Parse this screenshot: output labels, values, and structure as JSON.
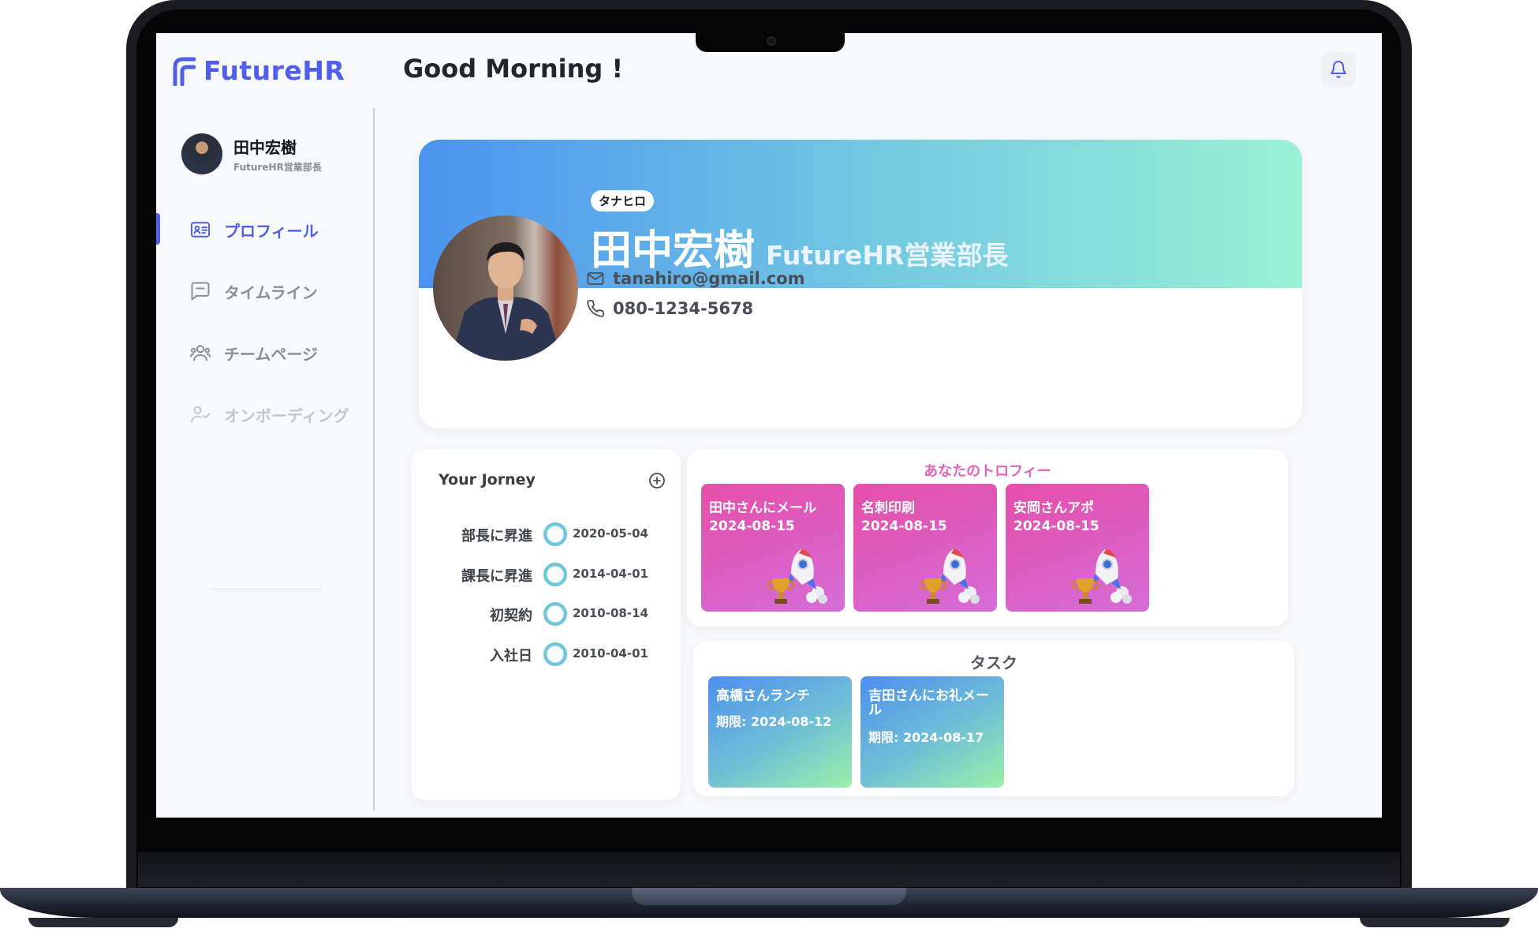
{
  "brand": {
    "name": "FutureHR",
    "color": "#4f5fe8"
  },
  "header": {
    "greeting": "Good Morning !",
    "bell_icon": "bell-icon"
  },
  "sidebar": {
    "user": {
      "name": "田中宏樹",
      "role": "FutureHR営業部長"
    },
    "items": [
      {
        "label": "プロフィール",
        "icon": "id-card-icon",
        "active": true
      },
      {
        "label": "タイムライン",
        "icon": "message-square-icon",
        "active": false
      },
      {
        "label": "チームページ",
        "icon": "users-icon",
        "active": false
      },
      {
        "label": "オンボーディング",
        "icon": "user-check-icon",
        "active": false,
        "disabled": true
      }
    ]
  },
  "profile": {
    "nickname": "タナヒロ",
    "name": "田中宏樹",
    "role": "FutureHR営業部長",
    "email": "tanahiro@gmail.com",
    "phone": "080-1234-5678"
  },
  "journey": {
    "title": "Your Jorney",
    "events": [
      {
        "label": "部長に昇進",
        "date": "2020-05-04"
      },
      {
        "label": "課長に昇進",
        "date": "2014-04-01"
      },
      {
        "label": "初契約",
        "date": "2010-08-14"
      },
      {
        "label": "入社日",
        "date": "2010-04-01"
      }
    ]
  },
  "trophies": {
    "title": "あなたのトロフィー",
    "items": [
      {
        "title": "田中さんにメール",
        "date": "2024-08-15"
      },
      {
        "title": "名刺印刷",
        "date": "2024-08-15"
      },
      {
        "title": "安岡さんアポ",
        "date": "2024-08-15"
      }
    ]
  },
  "tasks": {
    "title": "タスク",
    "items": [
      {
        "title": "高橋さんランチ",
        "due": "期限: 2024-08-12"
      },
      {
        "title": "吉田さんにお礼メール",
        "due": "期限: 2024-08-17"
      }
    ]
  }
}
